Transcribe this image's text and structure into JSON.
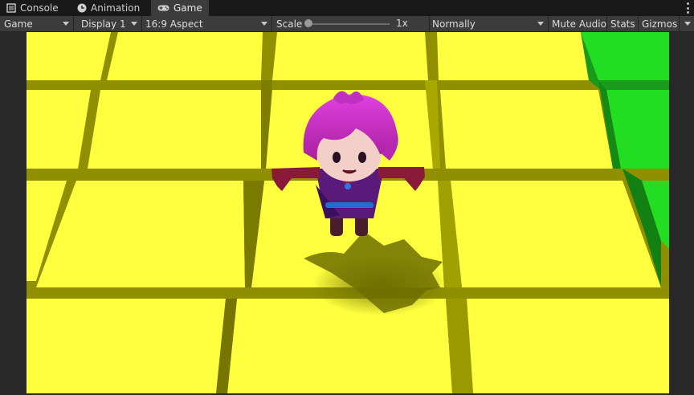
{
  "tabs": [
    {
      "label": "Console",
      "icon": "console-icon"
    },
    {
      "label": "Animation",
      "icon": "animation-clock-icon"
    },
    {
      "label": "Game",
      "icon": "gamepad-icon",
      "active": true
    }
  ],
  "toolbar": {
    "display_mode": "Game",
    "display": "Display 1",
    "aspect": "16:9 Aspect",
    "scale_label": "Scale",
    "scale_value": "1x",
    "play_mode": "Normally",
    "mute_audio": "Mute Audio",
    "stats": "Stats",
    "gizmos": "Gizmos"
  },
  "colors": {
    "tile_top": "#ffff40",
    "tile_side": "#8f8f00",
    "green_top": "#22dd22",
    "hair": "#cc33cc",
    "dress": "#5a1a7a",
    "belt": "#1e6fd0"
  }
}
